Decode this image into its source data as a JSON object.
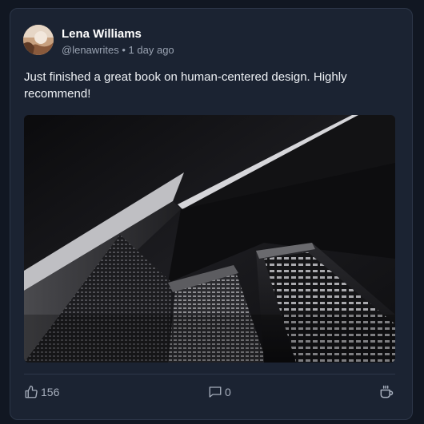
{
  "post": {
    "author_name": "Lena Williams",
    "handle": "@lenawrites",
    "separator": "•",
    "timestamp": "1 day ago",
    "body": "Just finished a great book on human-centered design. Highly recommend!",
    "image_alt": "Black and white photo looking up at angular skyscrapers"
  },
  "actions": {
    "likes": "156",
    "comments": "0",
    "like_icon": "thumbs-up-icon",
    "comment_icon": "comment-icon",
    "share_icon": "coffee-cup-icon"
  },
  "colors": {
    "background": "#111722",
    "card": "#1b2332",
    "text": "#eef1f5",
    "muted": "#9aa3b2"
  }
}
